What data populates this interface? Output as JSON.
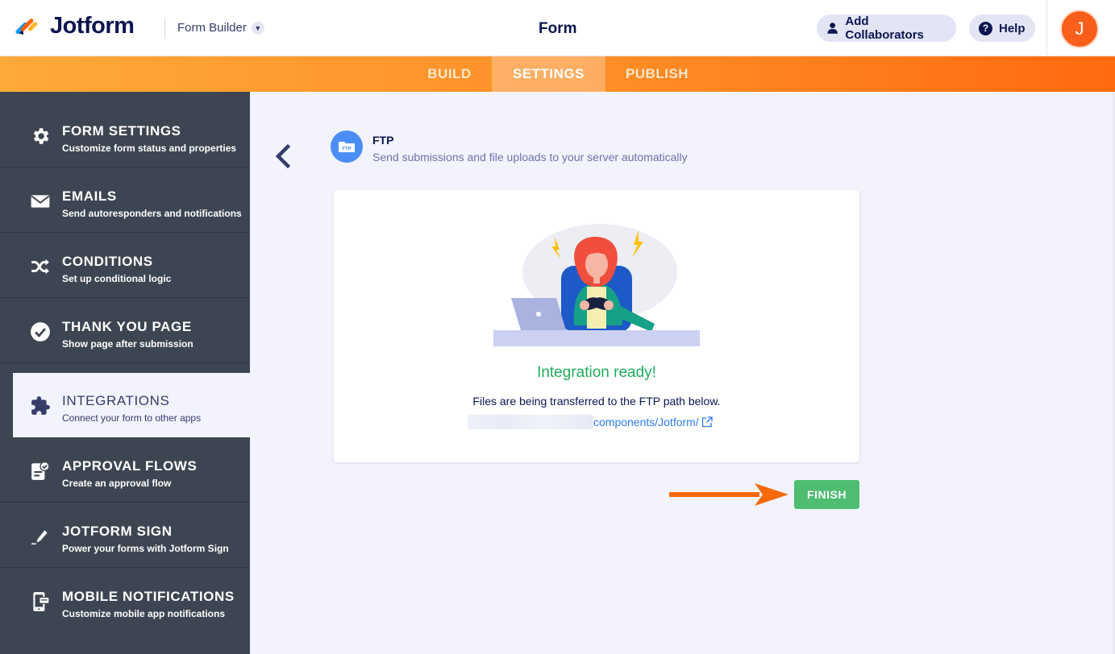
{
  "header": {
    "brand": "Jotform",
    "builder_label": "Form Builder",
    "title": "Form",
    "add_collaborators": "Add Collaborators",
    "help": "Help",
    "help_glyph": "?",
    "avatar_initial": "J"
  },
  "nav": {
    "tabs": [
      {
        "label": "BUILD",
        "active": false
      },
      {
        "label": "SETTINGS",
        "active": true
      },
      {
        "label": "PUBLISH",
        "active": false
      }
    ]
  },
  "sidebar": {
    "items": [
      {
        "title": "FORM SETTINGS",
        "subtitle": "Customize form status and properties",
        "icon": "gear-icon"
      },
      {
        "title": "EMAILS",
        "subtitle": "Send autoresponders and notifications",
        "icon": "envelope-icon"
      },
      {
        "title": "CONDITIONS",
        "subtitle": "Set up conditional logic",
        "icon": "shuffle-icon"
      },
      {
        "title": "THANK YOU PAGE",
        "subtitle": "Show page after submission",
        "icon": "check-circle-icon"
      },
      {
        "title": "INTEGRATIONS",
        "subtitle": "Connect your form to other apps",
        "icon": "puzzle-icon",
        "active": true
      },
      {
        "title": "APPROVAL FLOWS",
        "subtitle": "Create an approval flow",
        "icon": "approval-icon"
      },
      {
        "title": "JOTFORM SIGN",
        "subtitle": "Power your forms with Jotform Sign",
        "icon": "pen-icon"
      },
      {
        "title": "MOBILE NOTIFICATIONS",
        "subtitle": "Customize mobile app notifications",
        "icon": "mobile-icon"
      }
    ]
  },
  "integration": {
    "name": "FTP",
    "description": "Send submissions and file uploads to your server automatically",
    "status": "Integration ready!",
    "status_detail": "Files are being transferred to the FTP path below.",
    "path_visible": "components/Jotform/",
    "finish_label": "FINISH"
  },
  "colors": {
    "orange": "#ff8d25",
    "sidebar": "#3e4552",
    "success": "#1fae5a",
    "finish": "#4ebd72",
    "link": "#2b7df0",
    "navy": "#0a1551"
  }
}
